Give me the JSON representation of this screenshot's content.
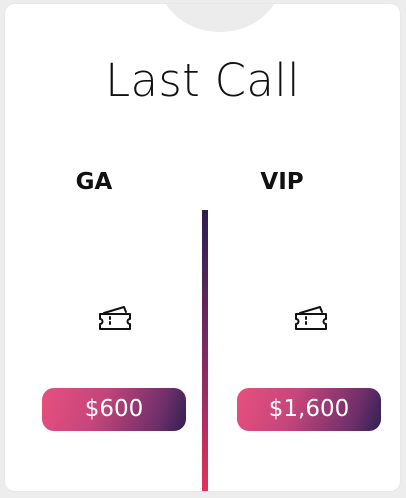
{
  "title": "Last Call",
  "tiers": [
    {
      "name": "GA",
      "icon": "ticket-icon",
      "price": "$600"
    },
    {
      "name": "VIP",
      "icon": "ticket-icon",
      "price": "$1,600"
    }
  ],
  "colors": {
    "divider_top": "#2b1f4f",
    "divider_bottom": "#e0335f",
    "price_gradient_start": "#e7507f",
    "price_gradient_end": "#2e2152"
  }
}
